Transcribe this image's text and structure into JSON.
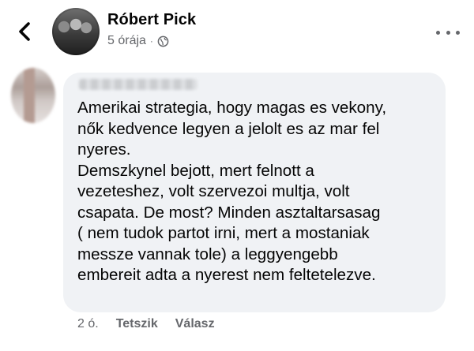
{
  "header": {
    "poster_name": "Róbert Pick",
    "time": "5 órája",
    "separator": "·",
    "privacy_icon": "globe-icon",
    "back_icon": "chevron-left-icon",
    "more_icon": "more-dots-icon"
  },
  "comment": {
    "text": "Amerikai strategia, hogy magas es vekony,\nnők kedvence legyen a jelolt es az mar fel\nnyeres.\nDemszkynel bejott, mert felnott a\nvezeteshez, volt szervezoi multja, volt\ncsapata. De most? Minden asztaltarsasag\n( nem tudok partot irni, mert a mostaniak\nmessze vannak tole) a leggyengebb\nembereit adta a nyerest nem feltetelezve.",
    "time": "2 ó.",
    "like_label": "Tetszik",
    "reply_label": "Válasz"
  },
  "colors": {
    "bubble": "#f0f2f5",
    "secondary_text": "#65676b",
    "primary_text": "#050505"
  }
}
